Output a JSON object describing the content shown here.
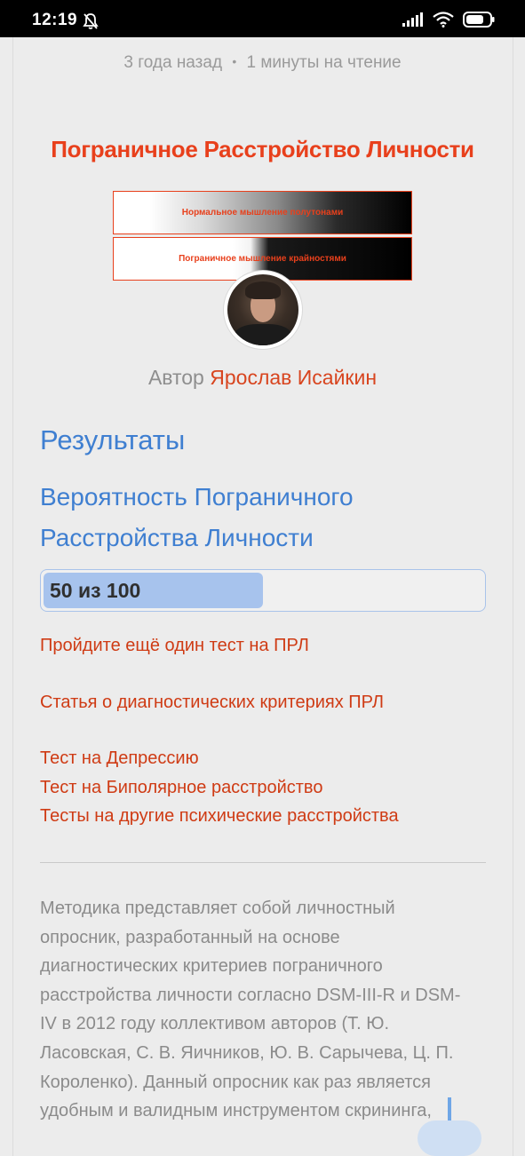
{
  "status_bar": {
    "time": "12:19",
    "icons": [
      "bell-off-icon",
      "signal-icon",
      "wifi-icon",
      "battery-icon"
    ]
  },
  "article": {
    "meta_age": "3 года назад",
    "meta_separator": "•",
    "meta_read": "1 минуты на чтение",
    "hero": {
      "title": "Пограничное Расстройство Личности",
      "box1": "Нормальное мышление полутонами",
      "box2": "Пограничное мышление крайностями"
    },
    "author_prefix": "Автор",
    "author_name": "Ярослав Исайкин"
  },
  "results": {
    "heading": "Результаты",
    "probability_heading": "Вероятность Пограничного Расстройства Личности",
    "score_label": "50 из 100",
    "score": 50,
    "score_max": 100
  },
  "links": {
    "retake": "Пройдите ещё один тест на ПРЛ",
    "criteria": "Статья о диагностических критериях ПРЛ",
    "depression": "Тест на Депрессию",
    "bipolar": "Тест на Биполярное расстройство",
    "other": "Тесты на другие психические расстройства"
  },
  "description": "Методика представляет собой личностный опросник, разработанный на основе диагностических критериев пограничного расстройства личности согласно DSM-III-R и DSM-IV в 2012 году коллективом авторов (Т. Ю. Ласовская, С. В. Яичников, Ю. В. Сарычева, Ц. П. Короленко). Данный опросник как раз является удобным и валидным инструментом скрининга,",
  "colors": {
    "accent_blue": "#3f7fd1",
    "accent_red": "#e8401c",
    "link_red": "#cf3b14",
    "progress_fill": "#a7c3ed"
  }
}
